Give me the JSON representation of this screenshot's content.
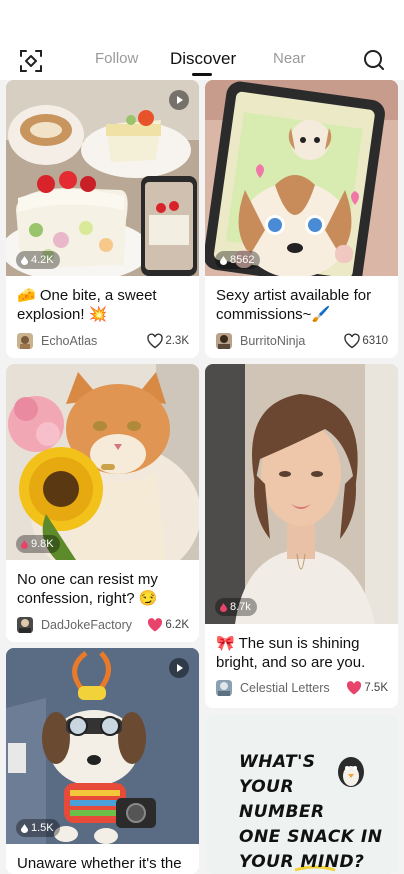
{
  "header": {
    "tabs": [
      {
        "label": "Follow",
        "active": false
      },
      {
        "label": "Discover",
        "active": true
      },
      {
        "label": "Near",
        "active": false
      }
    ],
    "left_icon": "scan-icon",
    "right_icon": "search-icon"
  },
  "colors": {
    "accent": "#e8436a",
    "text": "#111111",
    "muted": "#9a9a9a",
    "feed_bg": "#f3f3f3"
  },
  "posts": [
    {
      "views": "4.2K",
      "title_emoji": "🧀",
      "title": "One bite, a sweet explosion!",
      "title_end_emoji": "💥",
      "author": "EchoAtlas",
      "likes": "2.3K",
      "liked": false,
      "video": true
    },
    {
      "views": "8562",
      "title": "Sexy artist available for commissions~",
      "title_end_emoji": "🖌️",
      "author": "BurritoNinja",
      "likes": "6310",
      "liked": false,
      "video": false
    },
    {
      "views": "9.8K",
      "title": "No one can resist my confession, right?",
      "title_end_emoji": "😏",
      "author": "DadJokeFactory",
      "likes": "6.2K",
      "liked": true,
      "video": false
    },
    {
      "views": "8.7k",
      "title_emoji": "🎀",
      "title": "The sun is shining bright, and so are you.",
      "author": "Celestial Letters",
      "likes": "7.5K",
      "liked": true,
      "video": false
    },
    {
      "views": "1.5K",
      "title": "Unaware whether it's the",
      "video": true
    },
    {
      "poster_text": [
        "WHAT'S",
        "YOUR",
        "NUMBER",
        "ONE SNACK IN",
        "YOUR MIND?"
      ]
    }
  ]
}
